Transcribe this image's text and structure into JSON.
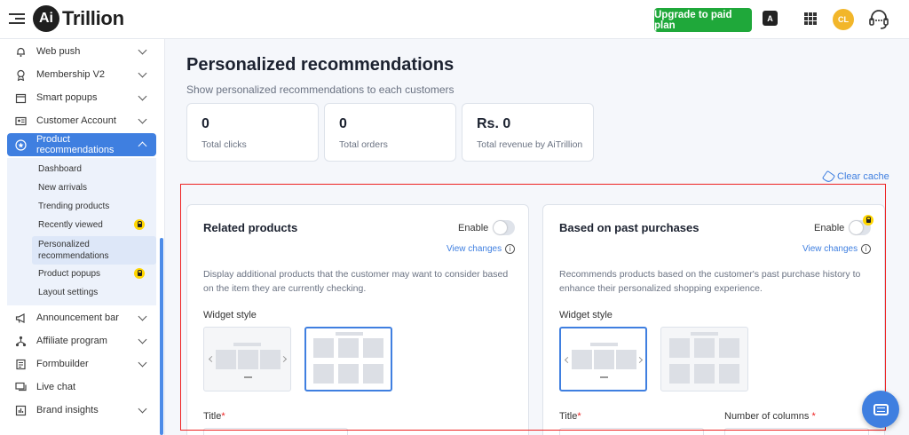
{
  "header": {
    "logo_mark": "Ai",
    "logo_text": "Trillion",
    "upgrade_label": "Upgrade to paid plan",
    "avatar_initials": "CL",
    "brand_color": "#1fa83a"
  },
  "sidebar": {
    "items": [
      {
        "label": "Web push",
        "icon": "bell-icon"
      },
      {
        "label": "Membership V2",
        "icon": "award-icon"
      },
      {
        "label": "Smart popups",
        "icon": "popup-icon"
      },
      {
        "label": "Customer Account",
        "icon": "id-card-icon"
      },
      {
        "label": "Product recommendations",
        "icon": "star-badge-icon",
        "active": true
      },
      {
        "label": "Announcement bar",
        "icon": "megaphone-icon"
      },
      {
        "label": "Affiliate program",
        "icon": "network-icon"
      },
      {
        "label": "Formbuilder",
        "icon": "form-icon"
      },
      {
        "label": "Live chat",
        "icon": "chat-icon"
      },
      {
        "label": "Brand insights",
        "icon": "chart-icon"
      }
    ],
    "subitems": [
      {
        "label": "Dashboard"
      },
      {
        "label": "New arrivals"
      },
      {
        "label": "Trending products"
      },
      {
        "label": "Recently viewed",
        "locked": true
      },
      {
        "label_line1": "Personalized",
        "label_line2": "recommendations",
        "selected": true
      },
      {
        "label": "Product popups",
        "locked": true
      },
      {
        "label": "Layout settings"
      }
    ],
    "accent_color": "#3f7fe0"
  },
  "main": {
    "title": "Personalized recommendations",
    "subtitle": "Show personalized recommendations to each customers",
    "stats": [
      {
        "value": "0",
        "label": "Total clicks"
      },
      {
        "value": "0",
        "label": "Total orders"
      },
      {
        "value": "Rs. 0",
        "label": "Total revenue by AiTrillion"
      }
    ],
    "clear_cache_label": "Clear cache",
    "panels": [
      {
        "title": "Related products",
        "enable_label": "Enable",
        "enabled": false,
        "view_changes_label": "View changes",
        "description": "Display additional products that the customer may want to consider based on the item they are currently checking.",
        "widget_style_label": "Widget style",
        "selected_style": "grid",
        "title_field_label": "Title"
      },
      {
        "title": "Based on past purchases",
        "enable_label": "Enable",
        "enabled": false,
        "locked": true,
        "view_changes_label": "View changes",
        "description": "Recommends products based on the customer's past purchase history to enhance their personalized shopping experience.",
        "widget_style_label": "Widget style",
        "selected_style": "carousel",
        "title_field_label": "Title",
        "columns_field_label": "Number of columns"
      }
    ],
    "required_mark": "*"
  }
}
